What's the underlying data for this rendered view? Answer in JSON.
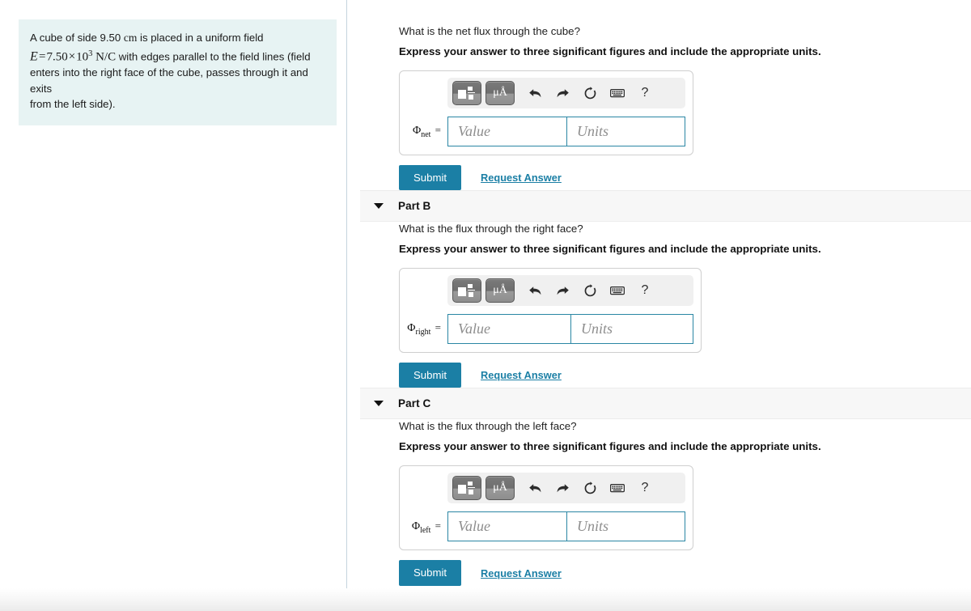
{
  "problem": {
    "line1_a": "A cube of side 9.50",
    "line1_unit": "cm",
    "line1_b": "is placed in a uniform field",
    "eq_var": "E",
    "eq_sign": "=",
    "eq_value": "7.50",
    "eq_times": "×",
    "eq_base": "10",
    "eq_exp": "3",
    "eq_units": "N/C",
    "line2_tail": "with edges parallel to the field lines (field",
    "line3": "enters into the right face of the cube, passes through it and exits",
    "line4": "from the left side)."
  },
  "toolbar": {
    "template_icon": "math-template-icon",
    "units_label": "μÅ",
    "undo_icon": "undo-arrow-icon",
    "redo_icon": "redo-arrow-icon",
    "reset_icon": "reset-circular-arrow-icon",
    "keyboard_icon": "keyboard-icon",
    "help_label": "?"
  },
  "common": {
    "instruction": "Express your answer to three significant figures and include the appropriate units.",
    "value_placeholder": "Value",
    "units_placeholder": "Units",
    "submit_label": "Submit",
    "request_answer_label": "Request Answer",
    "equals": "=",
    "phi": "Φ"
  },
  "colors": {
    "accent": "#1b7fa5",
    "field_border": "#2a86a4",
    "problem_bg": "#e7f3f3",
    "part_header_bg": "#f7f7f7",
    "toolbar_bg": "#f0f0f0"
  },
  "parts": [
    {
      "id": "part-a",
      "header_shown": false,
      "title": "Part A",
      "prompt": "What is the net flux through the cube?",
      "symbol_sub": "net",
      "box_size": "size-a"
    },
    {
      "id": "part-b",
      "header_shown": true,
      "title": "Part B",
      "prompt": "What is the flux through the right face?",
      "symbol_sub": "right",
      "box_size": "size-b"
    },
    {
      "id": "part-c",
      "header_shown": true,
      "title": "Part C",
      "prompt": "What is the flux through the left face?",
      "symbol_sub": "left",
      "box_size": "size-a"
    }
  ]
}
